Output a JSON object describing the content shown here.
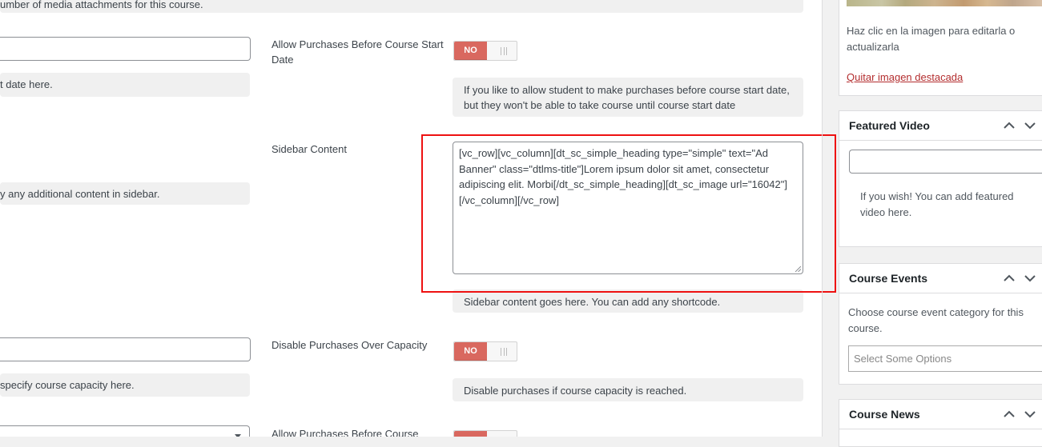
{
  "main": {
    "top_help_text": "umber of media attachments for this course.",
    "left_help_1": "t date here.",
    "allow_purchases_label": "Allow Purchases Before Course Start Date",
    "toggle_no": "NO",
    "allow_purchases_help": "If you like to allow student to make purchases before course start date, but they won't be able to take course until course start date",
    "left_help_2": "y any additional content in sidebar.",
    "sidebar_content_label": "Sidebar Content",
    "sidebar_content_value": "[vc_row][vc_column][dt_sc_simple_heading type=\"simple\" text=\"Ad Banner\" class=\"dtlms-title\"]Lorem ipsum dolor sit amet, consectetur adipiscing elit. Morbi[/dt_sc_simple_heading][dt_sc_image url=\"16042\"][/vc_column][/vc_row]",
    "sidebar_content_help": "Sidebar content goes here. You can add any shortcode.",
    "disable_purchases_label": "Disable Purchases Over Capacity",
    "left_help_3": "specify course capacity here.",
    "disable_purchases_help": "Disable purchases if course capacity is reached.",
    "allow_purchases_label_2": "Allow Purchases Before Course"
  },
  "sidebar": {
    "image_help": "Haz clic en la imagen para editarla o actualizarla",
    "remove_image_link": "Quitar imagen destacada",
    "featured_video": {
      "title": "Featured Video",
      "help": "If you wish! You can add featured video here."
    },
    "course_events": {
      "title": "Course Events",
      "help": "Choose course event category for this course.",
      "select_placeholder": "Select Some Options"
    },
    "course_news": {
      "title": "Course News"
    }
  },
  "colors": {
    "toggle_no": "#d9685f",
    "highlight_box": "#ee1111",
    "link": "#b32d2e"
  }
}
